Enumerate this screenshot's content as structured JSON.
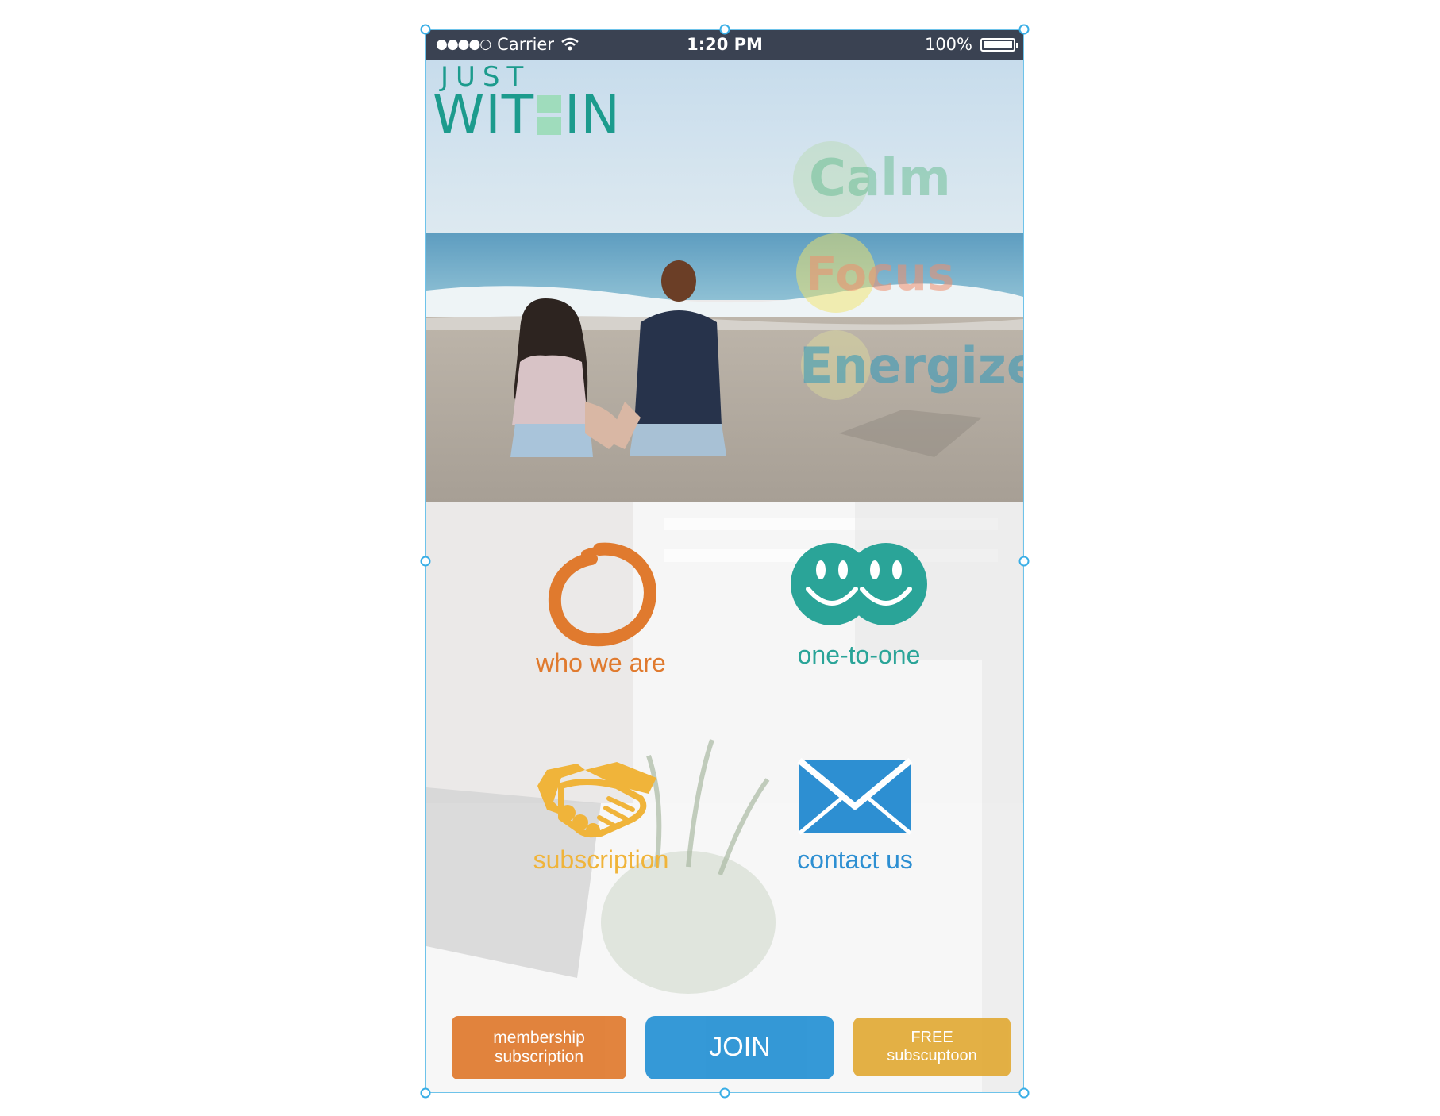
{
  "status_bar": {
    "signal": "●●●●○",
    "carrier": "Carrier",
    "time": "1:20 PM",
    "battery": "100%"
  },
  "logo": {
    "top": "JUST",
    "bottom_left": "WIT",
    "bottom_right": "IN"
  },
  "moods": [
    {
      "label": "Calm",
      "color": "#7fc6a2"
    },
    {
      "label": "Focus",
      "color": "#f0a58a"
    },
    {
      "label": "Energize",
      "color": "#3aa2c2"
    }
  ],
  "menu": {
    "who_we_are": {
      "label": "who we are",
      "color": "#e07a2e",
      "icon": "enso-circle-icon"
    },
    "one_to_one": {
      "label": "one-to-one",
      "color": "#2aa498",
      "icon": "smiley-faces-icon"
    },
    "subscription": {
      "label": "subscription",
      "color": "#f0b43a",
      "icon": "handshake-icon"
    },
    "contact_us": {
      "label": "contact us",
      "color": "#2d8fd2",
      "icon": "envelope-icon"
    }
  },
  "buttons": {
    "membership": {
      "line1": "membership",
      "line2": "subscription",
      "color": "#e07a2e"
    },
    "join": {
      "label": "JOIN",
      "color": "#2a93d5"
    },
    "free": {
      "line1": "FREE",
      "line2": "subscuptoon",
      "color": "#e2aa36"
    }
  }
}
